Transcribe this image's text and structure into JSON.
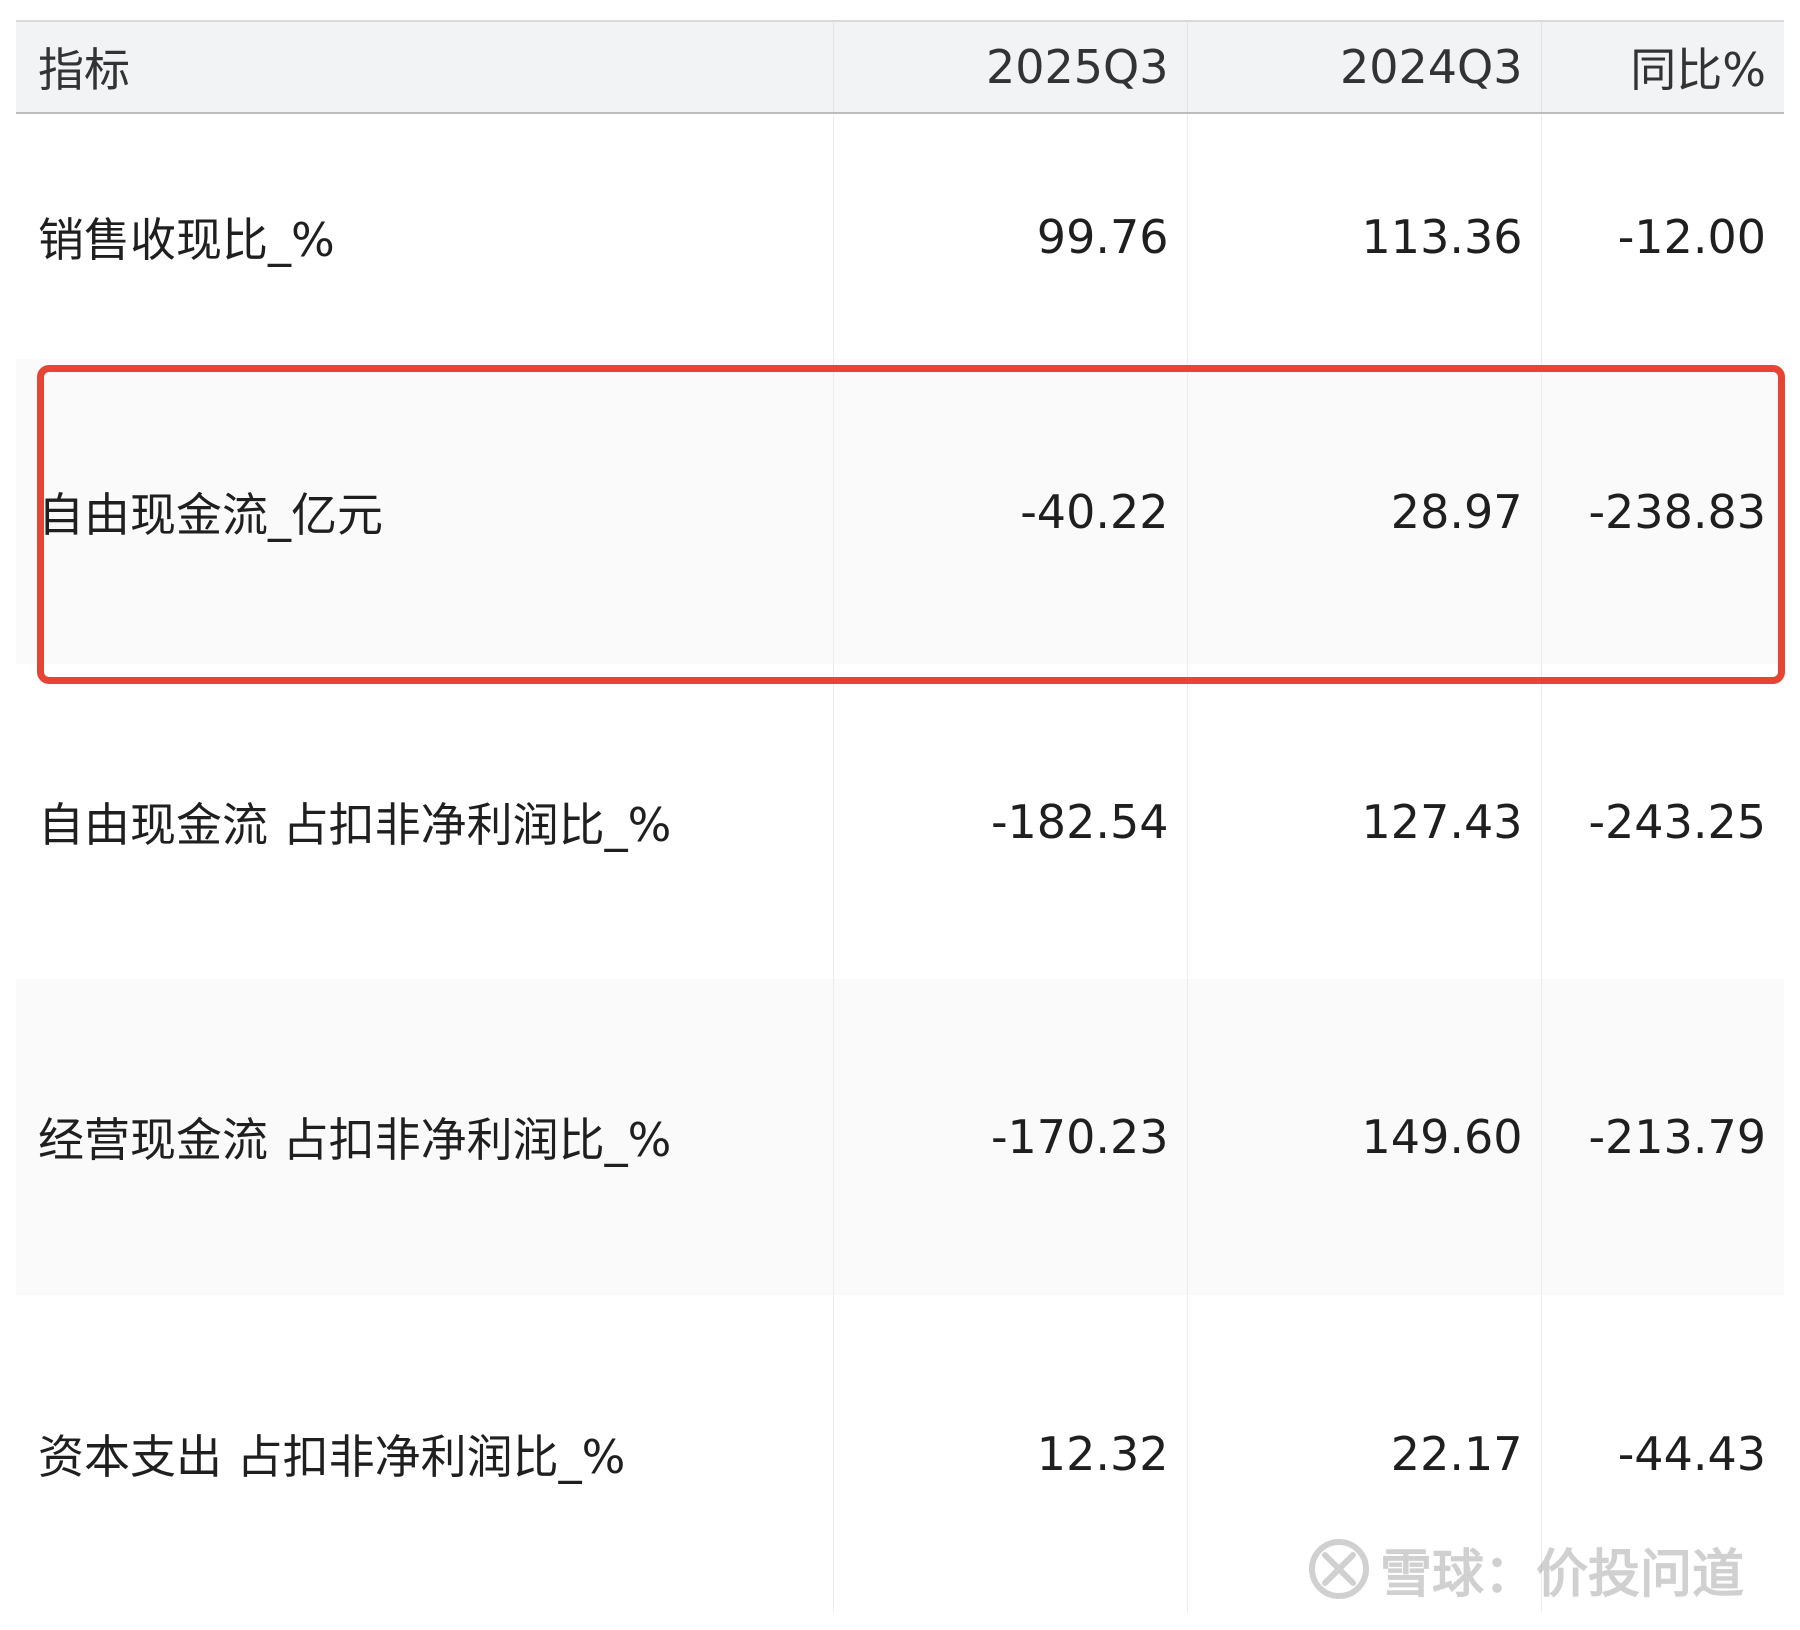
{
  "table": {
    "headers": [
      "指标",
      "2025Q3",
      "2024Q3",
      "同比%"
    ],
    "rows": [
      [
        "销售收现比_%",
        "99.76",
        "113.36",
        "-12.00"
      ],
      [
        "自由现金流_亿元",
        "-40.22",
        "28.97",
        "-238.83"
      ],
      [
        "自由现金流 占扣非净利润比_%",
        "-182.54",
        "127.43",
        "-243.25"
      ],
      [
        "经营现金流 占扣非净利润比_%",
        "-170.23",
        "149.60",
        "-213.79"
      ],
      [
        "资本支出 占扣非净利润比_%",
        "12.32",
        "22.17",
        "-44.43"
      ]
    ]
  },
  "highlight": {
    "row_index": 1,
    "color": "#e54532"
  },
  "watermark": {
    "text": "雪球：价投问道",
    "icon": "snowball-logo-icon"
  }
}
